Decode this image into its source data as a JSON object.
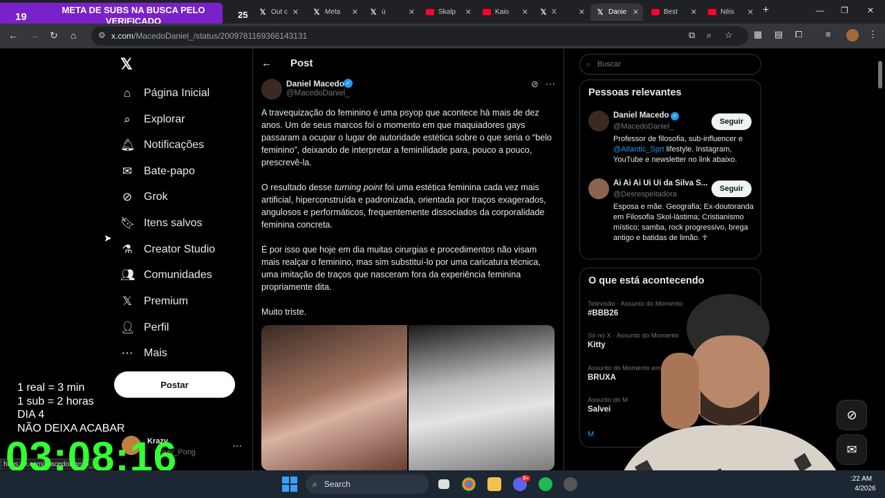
{
  "browser": {
    "tabs": [
      {
        "label": "Out c",
        "icon": "x-logo"
      },
      {
        "label": "Meta",
        "icon": "x-logo"
      },
      {
        "label": "ú",
        "icon": "x-logo"
      },
      {
        "label": "Skalp",
        "icon": "youtube-logo"
      },
      {
        "label": "Kaio",
        "icon": "youtube-logo"
      },
      {
        "label": "X",
        "icon": "x-logo"
      },
      {
        "label": "Danie",
        "icon": "x-logo",
        "active": true
      },
      {
        "label": "Best",
        "icon": "youtube-logo"
      },
      {
        "label": "Néis",
        "icon": "youtube-logo"
      }
    ],
    "url_host": "x.com",
    "url_path": "/MacedoDaniel_/status/2009781169366143131"
  },
  "overlay": {
    "badge_count": "19",
    "banner_text": "META DE SUBS NA BUSCA PELO VERIFICADO",
    "badge_count_2": "25",
    "rules": [
      "1 real = 3 min",
      "1 sub = 2 horas",
      "DIA 4",
      "NÃO DEIXA ACABAR"
    ],
    "timer": "03:08:16"
  },
  "sidebar": {
    "items": [
      {
        "label": "Página Inicial",
        "icon": "home-icon"
      },
      {
        "label": "Explorar",
        "icon": "search-icon"
      },
      {
        "label": "Notificações",
        "icon": "bell-icon"
      },
      {
        "label": "Bate-papo",
        "icon": "mail-icon"
      },
      {
        "label": "Grok",
        "icon": "grok-icon"
      },
      {
        "label": "Itens salvos",
        "icon": "bookmark-icon"
      },
      {
        "label": "Creator Studio",
        "icon": "creator-icon"
      },
      {
        "label": "Comunidades",
        "icon": "people-icon"
      },
      {
        "label": "Premium",
        "icon": "x-logo-icon"
      },
      {
        "label": "Perfil",
        "icon": "person-icon"
      },
      {
        "label": "Mais",
        "icon": "more-icon"
      }
    ],
    "post_button": "Postar",
    "account_name": "Krazy",
    "account_handle": "Krazy_Pong"
  },
  "post": {
    "header": "Post",
    "author_name": "Daniel Macedo",
    "author_handle": "@MacedoDaniel_",
    "paragraphs": [
      "A travequização do feminino é uma psyop que acontece há mais de dez anos. Um de seus marcos foi o momento em que maquiadores gays passaram a ocupar o lugar de autoridade estética sobre o que seria o “belo feminino”, deixando de interpretar a feminilidade para, pouco a pouco, prescrevê-la.",
      "O resultado desse ",
      "turning point",
      " foi uma estética feminina cada vez mais artificial, hiperconstruída e padronizada, orientada por traços exagerados, angulosos e performáticos, frequentemente dissociados da corporalidade feminina concreta.",
      "É por isso que hoje em dia muitas cirurgias e procedimentos não visam mais realçar o feminino, mas sim substituí-lo por uma caricatura técnica, uma imitação de traços que nasceram fora da experiência feminina propriamente dita.",
      "Muito triste."
    ]
  },
  "right": {
    "search_placeholder": "Buscar",
    "relevant_title": "Pessoas relevantes",
    "people": [
      {
        "name": "Daniel Macedo",
        "handle": "@MacedoDaniel_",
        "bio_pre": "Professor de filosofia, sub-influencer e ",
        "bio_link": "@Atlantic_Sprt",
        "bio_post": " lifestyle. Instagram, YouTube e newsletter no link abaixo.",
        "follow": "Seguir"
      },
      {
        "name": "Ai Ai Ai Ui Ui da Silva S...",
        "handle": "@Desrespeitadora",
        "bio_pre": "Esposa e mãe. Geografia; Ex-doutoranda em Filosofia Skol-lástima; Cristianismo místico; samba, rock progressivo, brega antigo e batidas de limão. ☥",
        "bio_link": "",
        "bio_post": "",
        "follow": "Seguir"
      }
    ],
    "trending_title": "O que está acontecendo",
    "trends": [
      {
        "meta": "Televisão · Assunto do Momento",
        "name": "#BBB26"
      },
      {
        "meta": "Só no X · Assunto do Momento",
        "name": "Kitty"
      },
      {
        "meta": "Assunto do Momento em Brasil",
        "name": "BRUXA"
      },
      {
        "meta": "Assunto do M",
        "name": "Salvei"
      }
    ],
    "show_more": "M"
  },
  "status_url": "https://x.com/MacedoDaniel_",
  "taskbar": {
    "search_label": "Search",
    "time": ":22 AM",
    "date": "4/2026",
    "badge": "9+"
  }
}
